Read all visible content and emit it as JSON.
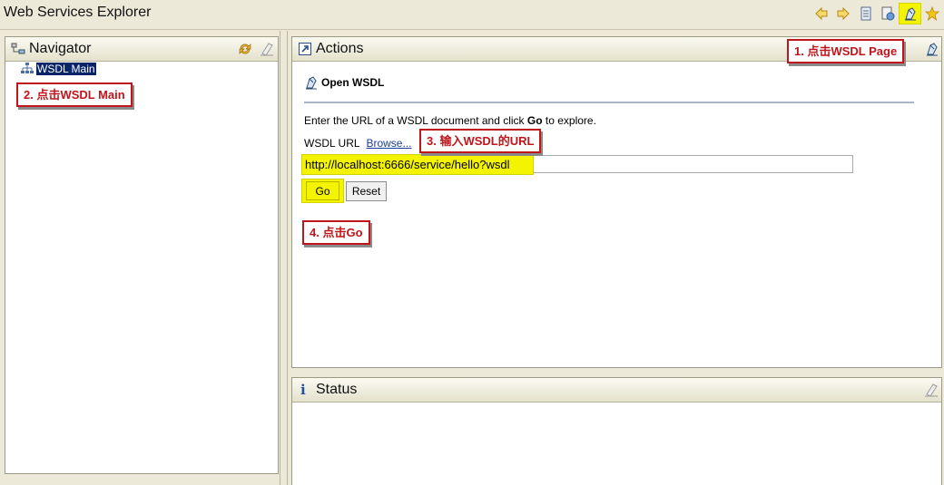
{
  "app": {
    "title": "Web Services Explorer"
  },
  "toolbar": {
    "back_icon": "arrow-left-icon",
    "forward_icon": "arrow-right-icon",
    "uddi_icon": "uddi-page-icon",
    "wsil_icon": "wsil-page-icon",
    "wsdl_icon": "wsdl-page-icon",
    "favorites_icon": "star-icon",
    "accent": "#f4f400"
  },
  "navigator": {
    "title": "Navigator",
    "tree": [
      {
        "label": "WSDL Main",
        "selected": true
      }
    ]
  },
  "actions": {
    "title": "Actions",
    "section_title": "Open WSDL",
    "instruction_prefix": "Enter the URL of a WSDL document and click ",
    "instruction_bold": "Go",
    "instruction_suffix": " to explore.",
    "url_label": "WSDL URL",
    "browse_link": "Browse...",
    "url_value": "http://localhost:6666/service/hello?wsdl",
    "go_label": "Go",
    "reset_label": "Reset"
  },
  "status": {
    "title": "Status"
  },
  "annotations": {
    "step1": "1. 点击WSDL Page",
    "step2": "2. 点击WSDL Main",
    "step3": "3. 输入WSDL的URL",
    "step4": "4. 点击Go",
    "color": "#c0151b"
  }
}
